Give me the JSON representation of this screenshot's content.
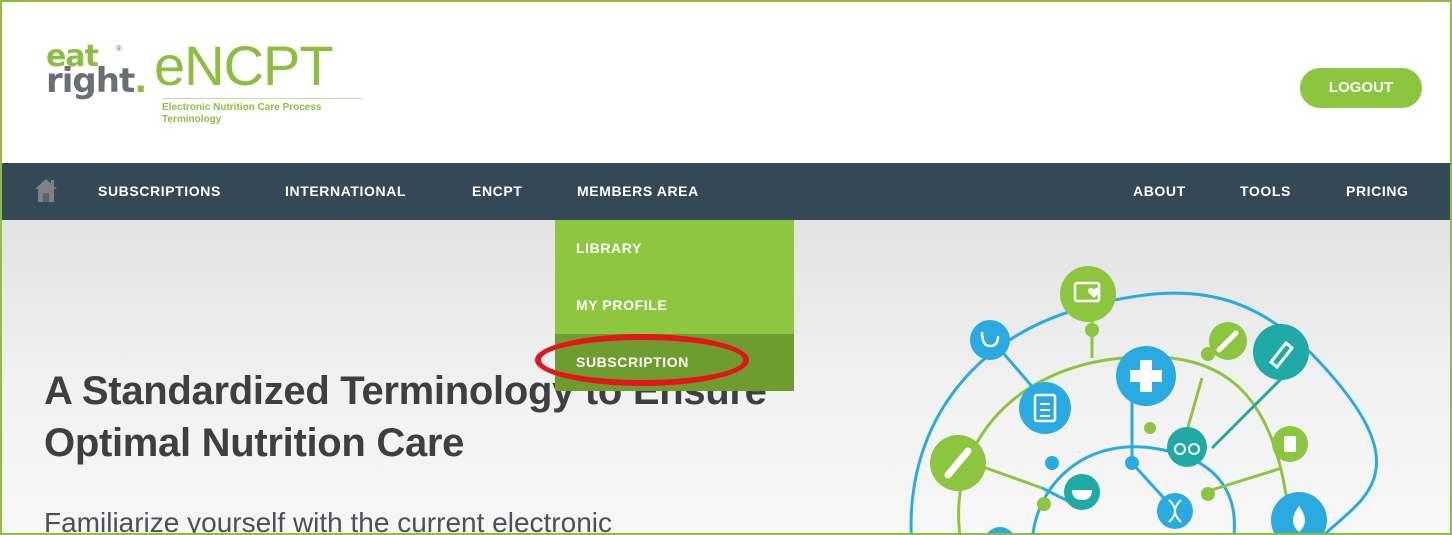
{
  "logo": {
    "eat": "eat",
    "right": "right",
    "registered": "®",
    "brand": "eNCPT",
    "subtitle": "Electronic Nutrition Care Process\nTerminology"
  },
  "header": {
    "logout_label": "LOGOUT"
  },
  "nav": {
    "home_icon": "home-icon",
    "left_items": [
      "SUBSCRIPTIONS",
      "INTERNATIONAL",
      "ENCPT",
      "MEMBERS AREA"
    ],
    "right_items": [
      "ABOUT",
      "TOOLS",
      "PRICING"
    ]
  },
  "dropdown": {
    "items": [
      "LIBRARY",
      "MY PROFILE",
      "SUBSCRIPTION"
    ],
    "active_item": "SUBSCRIPTION"
  },
  "hero": {
    "title": "A Standardized Terminology to Ensure Optimal Nutrition Care",
    "text": "Familiarize yourself with the current electronic"
  },
  "colors": {
    "brand_green": "#8cc63f",
    "nav_bg": "#344856",
    "dropdown_active": "#6f9c2f",
    "highlight_red": "#e3151c",
    "art_blue": "#29abe2",
    "art_teal": "#1fa9a7"
  },
  "illustration_icons": [
    "monitor-heart-icon",
    "syringe-icon",
    "stethoscope-icon",
    "test-tube-icon",
    "medical-cross-icon",
    "clipboard-icon",
    "glasses-icon",
    "pill-bottle-icon",
    "thermometer-icon",
    "mortar-pestle-icon",
    "dna-icon",
    "water-drop-icon"
  ]
}
